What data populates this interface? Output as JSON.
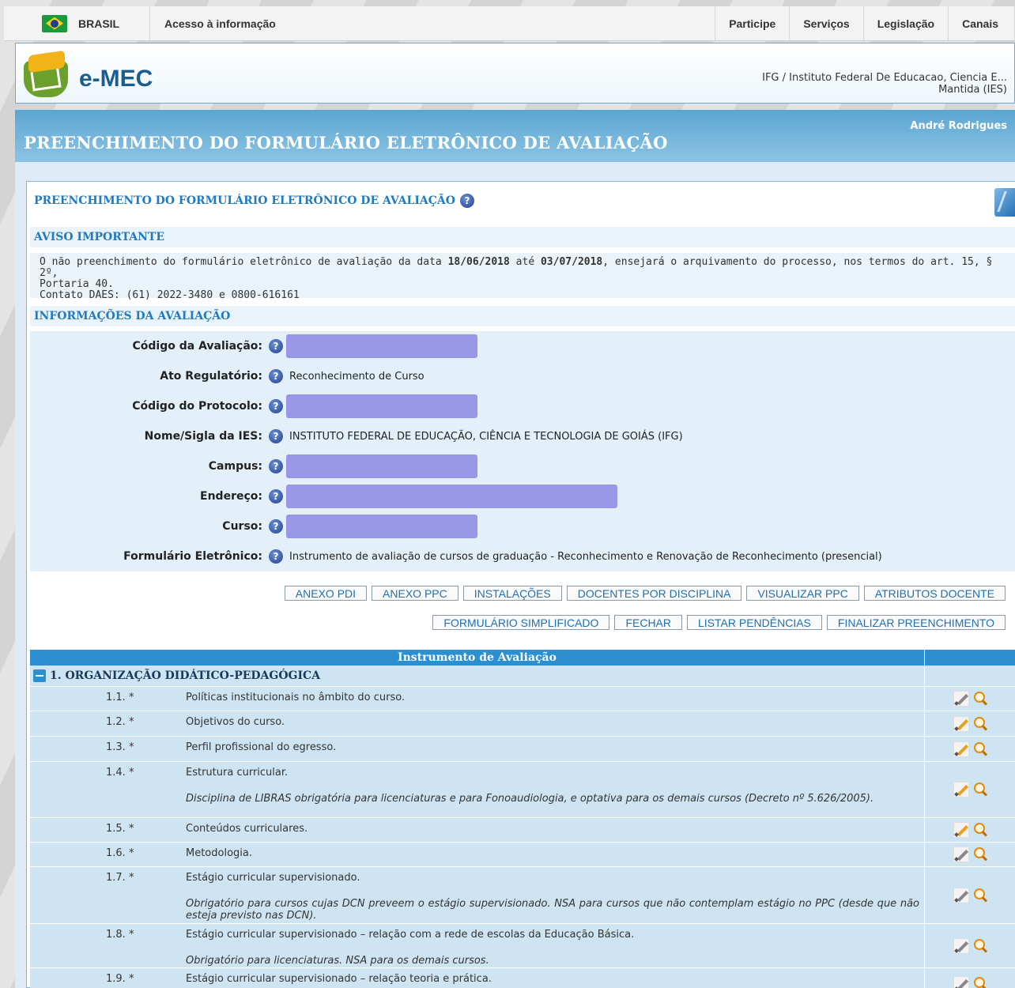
{
  "gov_bar": {
    "brasil": "BRASIL",
    "acesso": "Acesso à informação",
    "links": [
      "Participe",
      "Serviços",
      "Legislação",
      "Canais"
    ]
  },
  "header": {
    "logo_text": "e-MEC",
    "ies_line1": "IFG / Instituto Federal De Educacao, Ciencia E...",
    "ies_line2": "Mantida (IES)",
    "user_name": "André Rodrigues",
    "page_title": "PREENCHIMENTO DO FORMULÁRIO ELETRÔNICO DE AVALIAÇÃO"
  },
  "panel": {
    "title": "PREENCHIMENTO DO FORMULÁRIO ELETRÔNICO DE AVALIAÇÃO",
    "aviso_title": "AVISO IMPORTANTE",
    "aviso_pre": "O não preenchimento do formulário eletrônico de avaliação da data ",
    "aviso_date1": "18/06/2018",
    "aviso_mid": " até ",
    "aviso_date2": "03/07/2018",
    "aviso_post": ", ensejará o arquivamento do processo, nos termos do art. 15, § 2º,",
    "aviso_line2": "Portaria 40.",
    "aviso_line3": "Contato DAES: (61) 2022-3480 e 0800-616161",
    "info_title": "INFORMAÇÕES DA AVALIAÇÃO"
  },
  "info": {
    "codigo_avaliacao": "Código da Avaliação:",
    "ato_regulatorio": "Ato Regulatório:",
    "ato_regulatorio_value": "Reconhecimento de Curso",
    "codigo_protocolo": "Código do Protocolo:",
    "nome_ies": "Nome/Sigla da IES:",
    "nome_ies_value": "INSTITUTO FEDERAL DE EDUCAÇÃO, CIÊNCIA E TECNOLOGIA DE GOIÁS (IFG)",
    "campus": "Campus:",
    "endereco": "Endereço:",
    "curso": "Curso:",
    "formulario": "Formulário Eletrônico:",
    "formulario_value": "Instrumento de avaliação de cursos de graduação - Reconhecimento e Renovação de Reconhecimento (presencial)"
  },
  "buttons_row1": [
    "ANEXO PDI",
    "ANEXO PPC",
    "INSTALAÇÕES",
    "DOCENTES POR DISCIPLINA",
    "VISUALIZAR PPC",
    "ATRIBUTOS DOCENTE"
  ],
  "buttons_row2": [
    "FORMULÁRIO SIMPLIFICADO",
    "FECHAR",
    "LISTAR PENDÊNCIAS",
    "FINALIZAR PREENCHIMENTO"
  ],
  "table": {
    "header": "Instrumento de Avaliação",
    "section": "1. ORGANIZAÇÃO DIDÁTICO-PEDAGÓGICA",
    "items": [
      {
        "num": "1.1. *",
        "text": "Políticas institucionais no âmbito do curso.",
        "note": ""
      },
      {
        "num": "1.2. *",
        "text": "Objetivos do curso.",
        "note": ""
      },
      {
        "num": "1.3. *",
        "text": "Perfil profissional do egresso.",
        "note": ""
      },
      {
        "num": "1.4. *",
        "text": "Estrutura curricular.",
        "note": "Disciplina de LIBRAS obrigatória para licenciaturas e para Fonoaudiologia, e optativa para os demais cursos (Decreto nº 5.626/2005)."
      },
      {
        "num": "1.5. *",
        "text": "Conteúdos curriculares.",
        "note": ""
      },
      {
        "num": "1.6. *",
        "text": "Metodologia.",
        "note": ""
      },
      {
        "num": "1.7. *",
        "text": "Estágio curricular supervisionado.",
        "note": "Obrigatório para cursos cujas DCN preveem o estágio supervisionado. NSA para cursos que não contemplam estágio no PPC (desde que não esteja previsto nas DCN)."
      },
      {
        "num": "1.8. *",
        "text": "Estágio curricular supervisionado – relação com a rede de escolas da Educação Básica.",
        "note": "Obrigatório para licenciaturas. NSA para os demais cursos."
      },
      {
        "num": "1.9. *",
        "text": "Estágio curricular supervisionado – relação teoria e prática.",
        "note": ""
      }
    ]
  }
}
